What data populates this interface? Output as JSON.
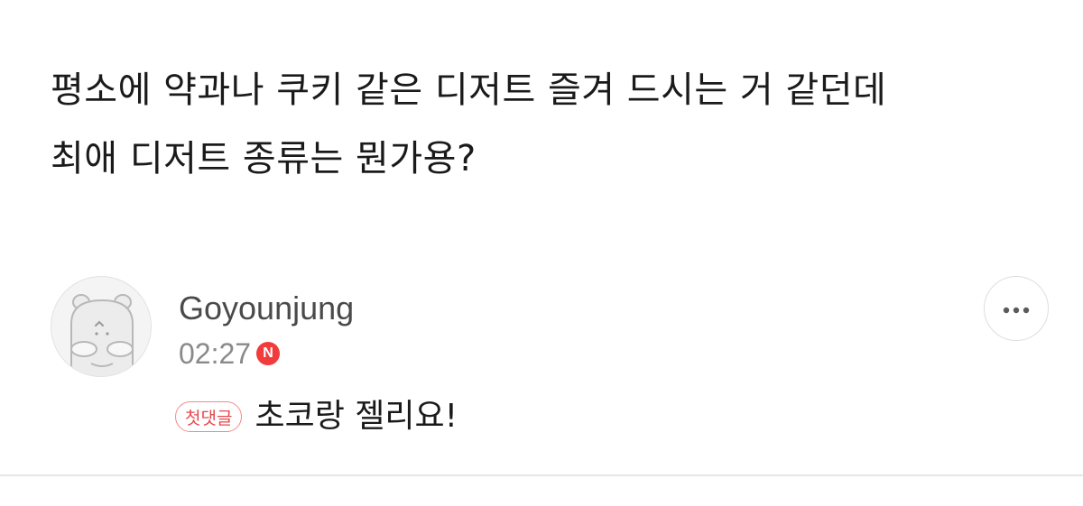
{
  "post": {
    "question_lines": [
      "평소에 약과나 쿠키 같은 디저트 즐겨 드시는 거 같던데",
      "최애 디저트 종류는 뭔가용?"
    ]
  },
  "comment": {
    "username": "Goyounjung",
    "timestamp": "02:27",
    "new_badge": "N",
    "first_comment_tag": "첫댓글",
    "text": "초코랑 젤리요!",
    "avatar_icon": "hamster-avatar-icon",
    "more_icon": "more-dots-icon"
  },
  "colors": {
    "accent_red": "#f03c3c",
    "tag_border": "#f28a8a",
    "divider": "#e6e6e6"
  }
}
